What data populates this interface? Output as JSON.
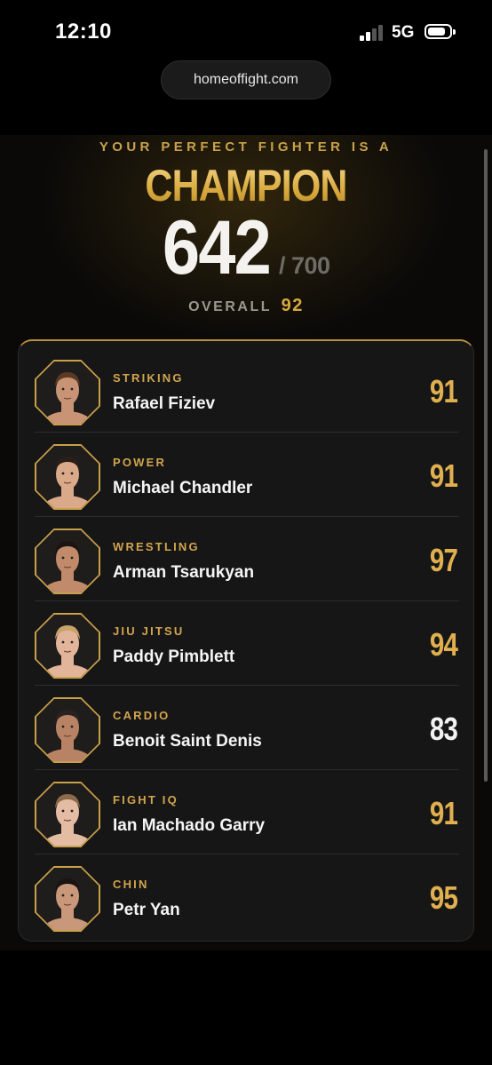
{
  "status_bar": {
    "time": "12:10",
    "network": "5G"
  },
  "browser": {
    "url": "homeoffight.com"
  },
  "result": {
    "subtitle": "YOUR PERFECT FIGHTER IS A",
    "rank": "CHAMPION",
    "score": "642",
    "score_max": "/ 700",
    "overall_label": "OVERALL",
    "overall_value": "92"
  },
  "colors": {
    "gold": "#d8a93c",
    "background": "#0a0908",
    "card": "#161617"
  },
  "fighters": [
    {
      "category": "STRIKING",
      "name": "Rafael Fiziev",
      "rating": "91",
      "rating_color": "gold",
      "icon": "fighter-portrait-icon"
    },
    {
      "category": "POWER",
      "name": "Michael Chandler",
      "rating": "91",
      "rating_color": "gold",
      "icon": "fighter-portrait-icon"
    },
    {
      "category": "WRESTLING",
      "name": "Arman Tsarukyan",
      "rating": "97",
      "rating_color": "gold",
      "icon": "fighter-portrait-icon"
    },
    {
      "category": "JIU JITSU",
      "name": "Paddy Pimblett",
      "rating": "94",
      "rating_color": "gold",
      "icon": "fighter-portrait-icon"
    },
    {
      "category": "CARDIO",
      "name": "Benoit Saint Denis",
      "rating": "83",
      "rating_color": "white",
      "icon": "fighter-portrait-icon"
    },
    {
      "category": "FIGHT IQ",
      "name": "Ian Machado Garry",
      "rating": "91",
      "rating_color": "gold",
      "icon": "fighter-portrait-icon"
    },
    {
      "category": "CHIN",
      "name": "Petr Yan",
      "rating": "95",
      "rating_color": "gold",
      "icon": "fighter-portrait-icon"
    }
  ]
}
